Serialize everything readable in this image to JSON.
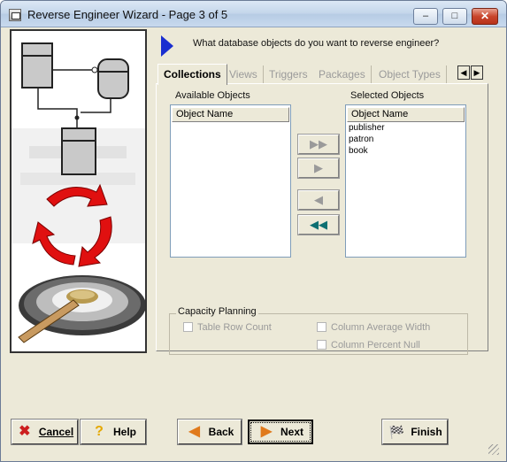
{
  "window": {
    "title": "Reverse Engineer Wizard - Page 3 of 5",
    "controls": {
      "minimize": "–",
      "maximize": "□",
      "close": "✕"
    }
  },
  "prompt": "What database objects do you want to reverse engineer?",
  "tabs": [
    {
      "label": "Collections",
      "active": true
    },
    {
      "label": "Views",
      "active": false
    },
    {
      "label": "Triggers",
      "active": false
    },
    {
      "label": "Packages",
      "active": false
    },
    {
      "label": "Object Types",
      "active": false
    }
  ],
  "available": {
    "label": "Available Objects",
    "column": "Object Name",
    "items": []
  },
  "selected": {
    "label": "Selected Objects",
    "column": "Object Name",
    "items": [
      "publisher",
      "patron",
      "book"
    ]
  },
  "move_buttons": {
    "add_all": "▶▶",
    "add": "▶",
    "remove": "◀",
    "remove_all": "◀◀"
  },
  "capacity": {
    "title": "Capacity Planning",
    "options": [
      "Table Row Count",
      "Column Average Width",
      "Column Percent Null"
    ]
  },
  "buttons": {
    "cancel": "Cancel",
    "help": "Help",
    "back": "Back",
    "next": "Next",
    "finish": "Finish"
  },
  "colors": {
    "accent_arrow": "#1a2fd0",
    "cancel_icon": "#cc1f1f",
    "next_icon": "#e07a1c"
  }
}
